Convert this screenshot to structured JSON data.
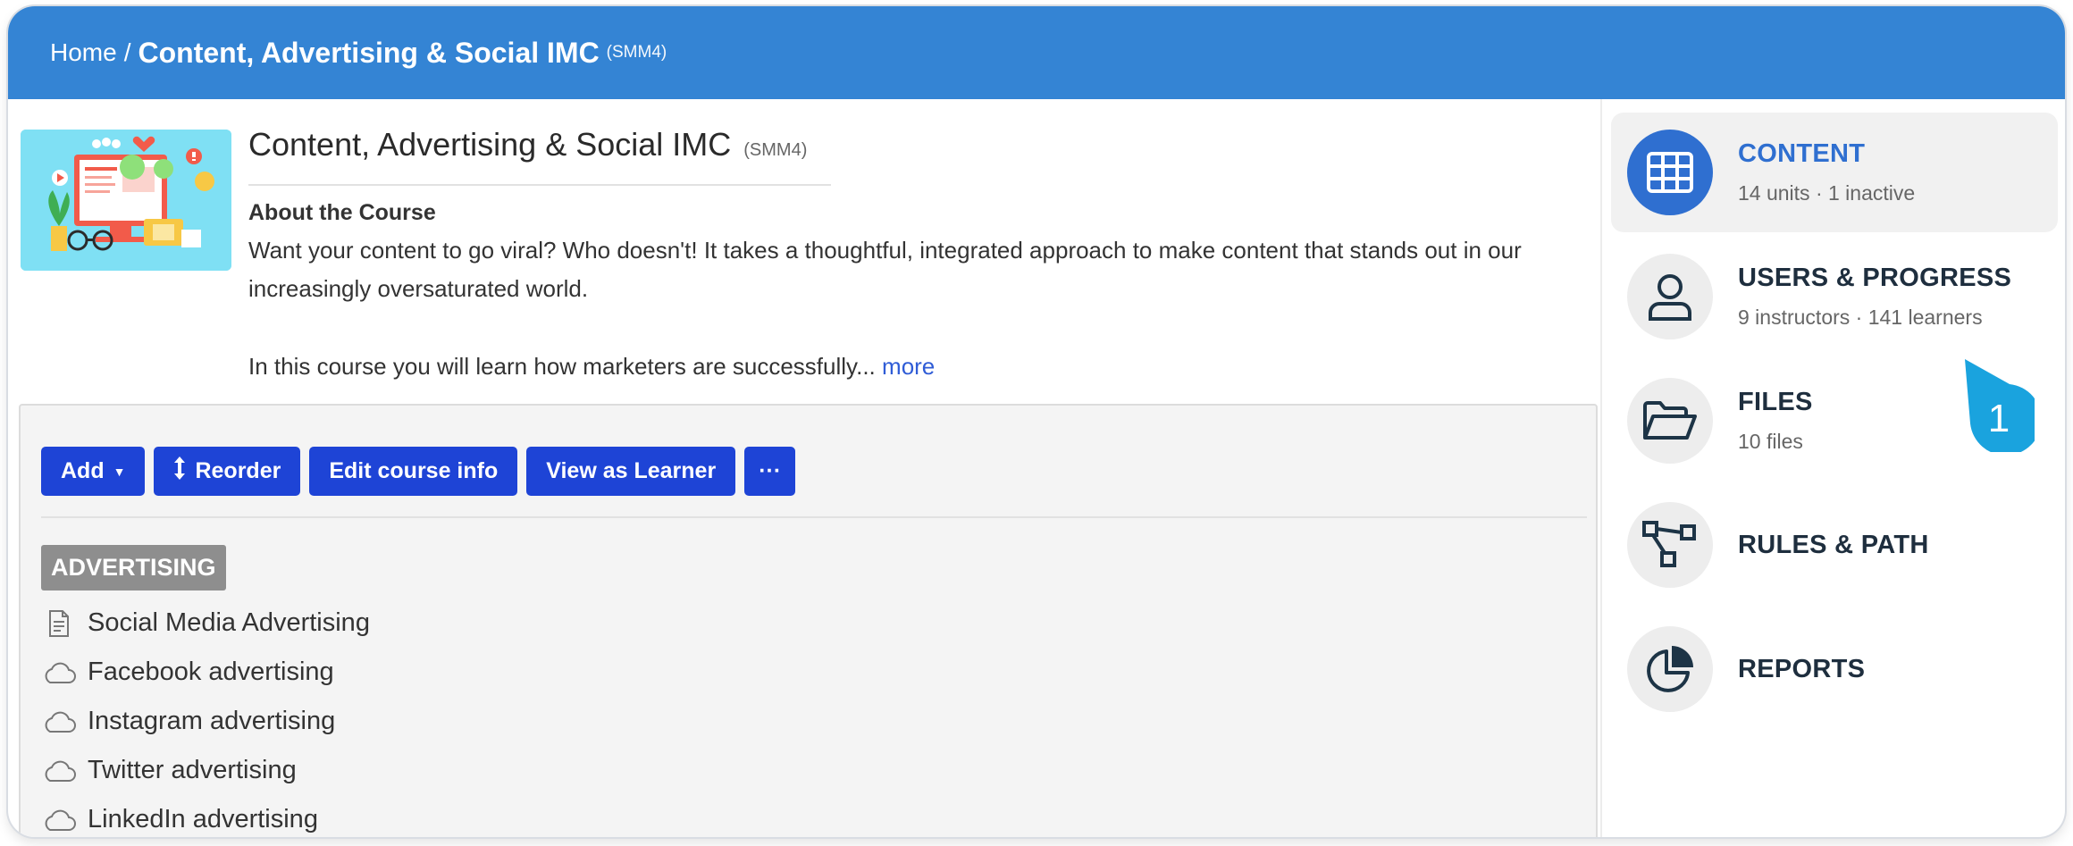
{
  "breadcrumb": {
    "home": "Home",
    "separator": "/",
    "title": "Content, Advertising & Social IMC",
    "code": "(SMM4)"
  },
  "course": {
    "title": "Content, Advertising & Social IMC",
    "code": "(SMM4)",
    "about_heading": "About the Course",
    "about_text": "Want your content to go viral? Who doesn't! It takes a thoughtful, integrated approach to make content that stands out in our increasingly oversaturated world.",
    "about_text_2": "In this course you will learn how marketers are successfully...",
    "more_link": "more"
  },
  "toolbar": {
    "add_label": "Add",
    "reorder_label": "Reorder",
    "edit_label": "Edit course info",
    "view_label": "View as Learner",
    "more_label": "···"
  },
  "section": {
    "name": "ADVERTISING",
    "units": [
      {
        "label": "Social Media Advertising",
        "icon": "document-icon"
      },
      {
        "label": "Facebook advertising",
        "icon": "cloud-icon"
      },
      {
        "label": "Instagram advertising",
        "icon": "cloud-icon"
      },
      {
        "label": "Twitter advertising",
        "icon": "cloud-icon"
      },
      {
        "label": "LinkedIn advertising",
        "icon": "cloud-icon"
      }
    ]
  },
  "sidebar": {
    "items": [
      {
        "title": "CONTENT",
        "subtitle": "14 units · 1 inactive",
        "icon": "grid-icon",
        "active": true
      },
      {
        "title": "USERS & PROGRESS",
        "subtitle": "9 instructors · 141 learners",
        "icon": "user-icon"
      },
      {
        "title": "FILES",
        "subtitle": "10 files",
        "icon": "folder-icon"
      },
      {
        "title": "RULES & PATH",
        "subtitle": "",
        "icon": "path-icon"
      },
      {
        "title": "REPORTS",
        "subtitle": "",
        "icon": "pie-chart-icon"
      }
    ]
  },
  "callout": {
    "number": "1"
  },
  "colors": {
    "header": "#3484d4",
    "button": "#1e44d6",
    "active": "#2f6fd0",
    "callout": "#1aa3de"
  }
}
